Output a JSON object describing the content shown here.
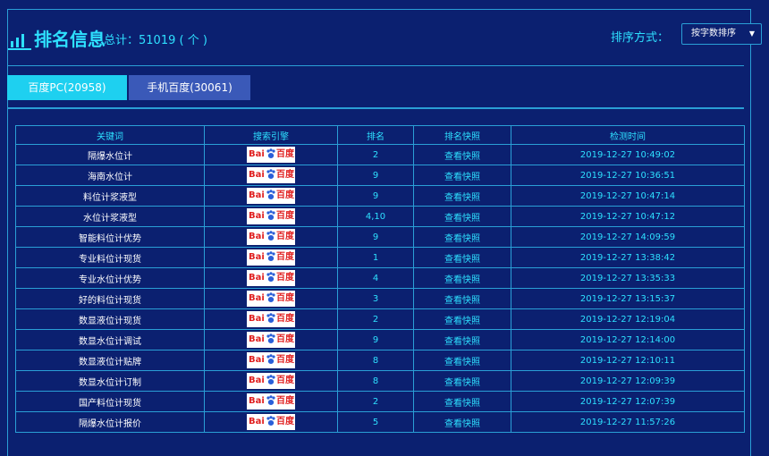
{
  "header": {
    "title": "排名信息",
    "total": "总计：51019 ( 个 )",
    "sort_label": "排序方式：",
    "sort_value": "按字数排序"
  },
  "tabs": [
    {
      "label": "百度PC(20958)",
      "active": true
    },
    {
      "label": "手机百度(30061)",
      "active": false
    }
  ],
  "table": {
    "columns": [
      "关键词",
      "搜索引擎",
      "排名",
      "排名快照",
      "检测时间"
    ],
    "engine_logo": {
      "left": "Bai",
      "right": "百度"
    },
    "rows": [
      {
        "keyword": "隔爆水位计",
        "rank": "2",
        "snapshot": "查看快照",
        "time": "2019-12-27 10:49:02"
      },
      {
        "keyword": "海南水位计",
        "rank": "9",
        "snapshot": "查看快照",
        "time": "2019-12-27 10:36:51"
      },
      {
        "keyword": "料位计浆液型",
        "rank": "9",
        "snapshot": "查看快照",
        "time": "2019-12-27 10:47:14"
      },
      {
        "keyword": "水位计浆液型",
        "rank": "4,10",
        "snapshot": "查看快照",
        "time": "2019-12-27 10:47:12"
      },
      {
        "keyword": "智能料位计优势",
        "rank": "9",
        "snapshot": "查看快照",
        "time": "2019-12-27 14:09:59"
      },
      {
        "keyword": "专业料位计现货",
        "rank": "1",
        "snapshot": "查看快照",
        "time": "2019-12-27 13:38:42"
      },
      {
        "keyword": "专业水位计优势",
        "rank": "4",
        "snapshot": "查看快照",
        "time": "2019-12-27 13:35:33"
      },
      {
        "keyword": "好的料位计现货",
        "rank": "3",
        "snapshot": "查看快照",
        "time": "2019-12-27 13:15:37"
      },
      {
        "keyword": "数显液位计现货",
        "rank": "2",
        "snapshot": "查看快照",
        "time": "2019-12-27 12:19:04"
      },
      {
        "keyword": "数显水位计调试",
        "rank": "9",
        "snapshot": "查看快照",
        "time": "2019-12-27 12:14:00"
      },
      {
        "keyword": "数显液位计贴牌",
        "rank": "8",
        "snapshot": "查看快照",
        "time": "2019-12-27 12:10:11"
      },
      {
        "keyword": "数显水位计订制",
        "rank": "8",
        "snapshot": "查看快照",
        "time": "2019-12-27 12:09:39"
      },
      {
        "keyword": "国产料位计现货",
        "rank": "2",
        "snapshot": "查看快照",
        "time": "2019-12-27 12:07:39"
      },
      {
        "keyword": "隔爆水位计报价",
        "rank": "5",
        "snapshot": "查看快照",
        "time": "2019-12-27 11:57:26"
      }
    ]
  },
  "colors": {
    "background": "#0b2070",
    "accent": "#2ee0ff",
    "border": "#2a9fd6",
    "tab_active": "#1ed0f0",
    "tab_inactive": "#3a59b8"
  }
}
